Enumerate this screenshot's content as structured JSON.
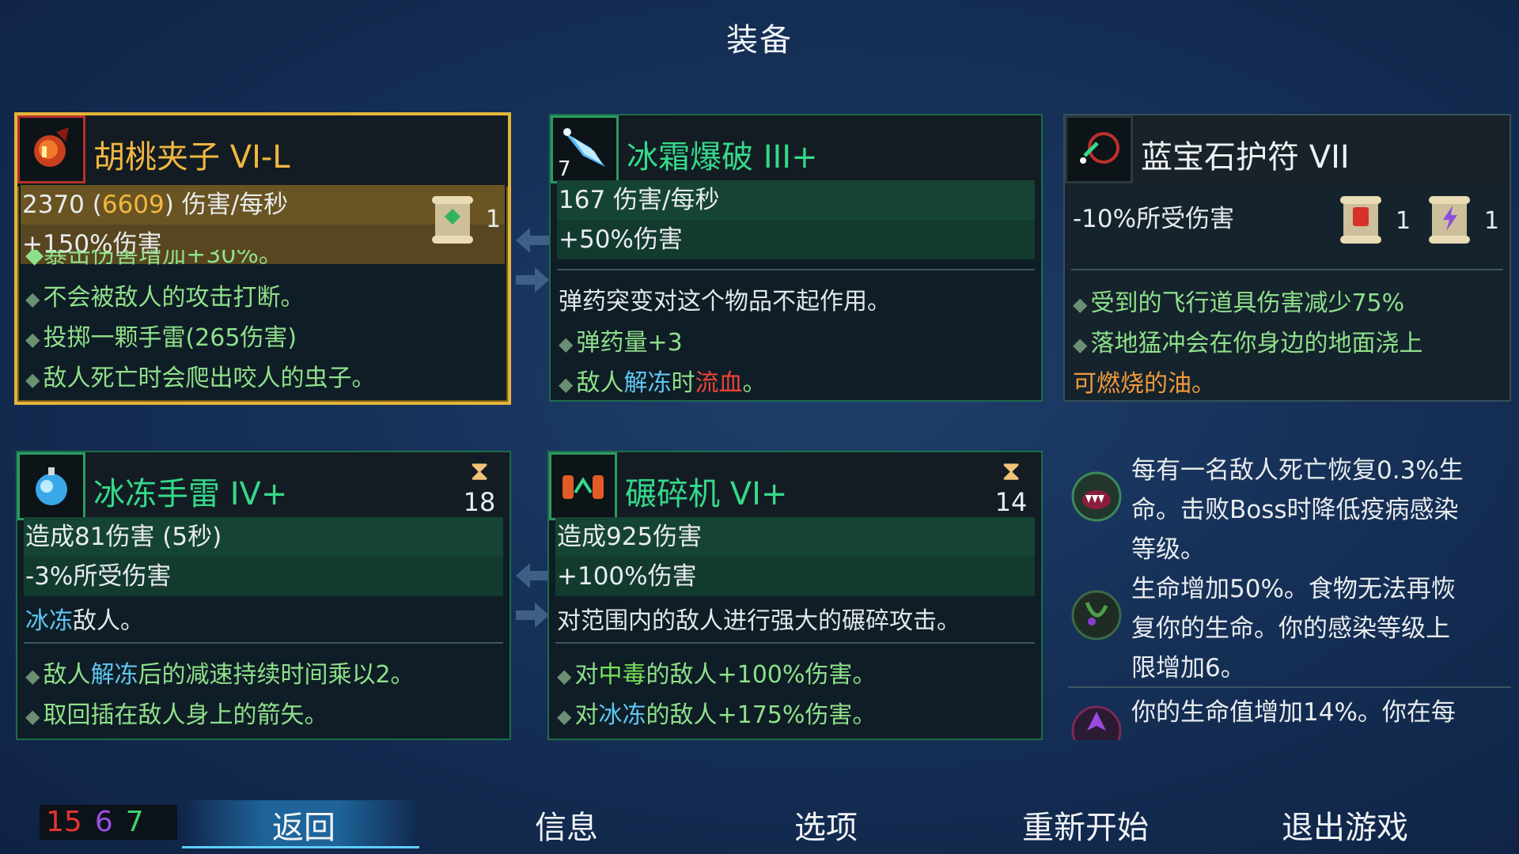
{
  "screen_title": "装备",
  "items": {
    "walnut": {
      "name": "胡桃夹子 VI-L",
      "dps_base": "2370",
      "dps_paren_open": " (",
      "dps_bonus": "6609",
      "dps_tail": ") 伤害/每秒",
      "stat2": "+150%伤害",
      "scroll_count": "1",
      "cut_line": "◆暴击伤害增加+30%。",
      "effects": [
        "不会被敌人的攻击打断。",
        "投掷一颗手雷(265伤害)",
        "敌人死亡时会爬出咬人的虫子。"
      ]
    },
    "frost": {
      "name": "冰霜爆破 III+",
      "icon_number": "7",
      "stat1": "167 伤害/每秒",
      "stat2": "+50%伤害",
      "note": "弹药突变对这个物品不起作用。",
      "effect1": "弹药量+3",
      "effect2_a": "敌人",
      "effect2_b": "解冻",
      "effect2_c": "时",
      "effect2_d": "流血",
      "effect2_e": "。"
    },
    "amulet": {
      "name": "蓝宝石护符 VII",
      "stat1": "-10%所受伤害",
      "scroll_red_count": "1",
      "scroll_purple_count": "1",
      "effect1": "受到的飞行道具伤害减少75%",
      "effect2_a": "落地猛冲会在你身边的地面浇上",
      "effect2_b": "可燃烧的油。"
    },
    "ice_grenade": {
      "name": "冰冻手雷 IV+",
      "cooldown": "18",
      "stat1": "造成81伤害 (5秒)",
      "stat2": "-3%所受伤害",
      "desc_a": "冰冻",
      "desc_b": "敌人。",
      "effect1_a": "敌人",
      "effect1_b": "解冻",
      "effect1_c": "后的减速持续时间乘以2。",
      "effect2": "取回插在敌人身上的箭矢。"
    },
    "crusher": {
      "name": "碾碎机 VI+",
      "cooldown": "14",
      "stat1": "造成925伤害",
      "stat2": "+100%伤害",
      "desc": "对范围内的敌人进行强大的碾碎攻击。",
      "effect1_a": "对",
      "effect1_b": "中毒",
      "effect1_c": "的敌人+100%伤害。",
      "effect2_a": "对",
      "effect2_b": "冰冻",
      "effect2_c": "的敌人+175%伤害。"
    }
  },
  "mutations": [
    {
      "icon": "vampire-mouth-icon",
      "lines": [
        "每有一名敌人死亡恢复0.3%生",
        "命。击败Boss时降低疫病感染",
        "等级。"
      ]
    },
    {
      "icon": "infected-face-icon",
      "lines": [
        "生命增加50%。食物无法再恢",
        "复你的生命。你的感染等级上",
        "限增加6。"
      ]
    },
    {
      "icon": "purple-head-icon",
      "lines": [
        "你的生命值增加14%。你在每"
      ]
    }
  ],
  "stats_points": {
    "brutality": "15",
    "tactics": "6",
    "survival": "7"
  },
  "menu": {
    "back": "返回",
    "info": "信息",
    "options": "选项",
    "restart": "重新开始",
    "quit": "退出游戏"
  },
  "colors": {
    "gold_border": "#e2b53a",
    "green_border": "#1d6c4d",
    "brutality": "#e8332e",
    "tactics": "#9c4fe0",
    "survival": "#3fd46e"
  }
}
